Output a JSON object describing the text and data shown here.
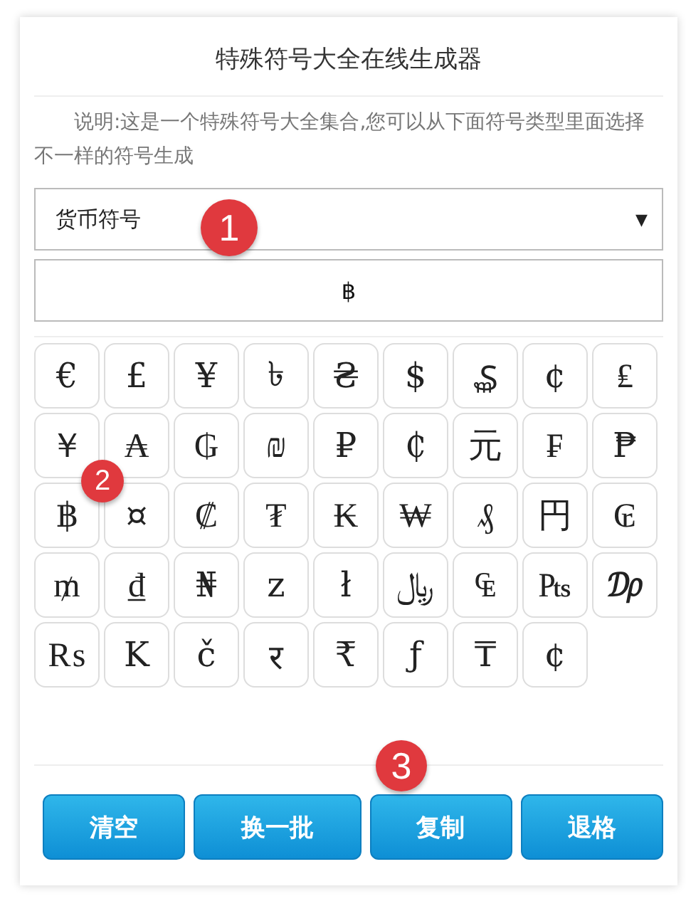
{
  "title": "特殊符号大全在线生成器",
  "description": "说明:这是一个特殊符号大全集合,您可以从下面符号类型里面选择不一样的符号生成",
  "category_select": {
    "value": "货币符号",
    "arrow": "▼"
  },
  "output": {
    "value": "฿"
  },
  "symbols": [
    "€",
    "£",
    "¥",
    "৳",
    "₴",
    "$",
    "₷",
    "¢",
    "₤",
    "￥",
    "₳",
    "₲",
    "₪",
    "₽",
    "₵",
    "元",
    "₣",
    "₱",
    "฿",
    "¤",
    "₡",
    "₮",
    "₭",
    "₩",
    "₰",
    "円",
    "₢",
    "₥",
    "₫",
    "₦",
    "z",
    "ł",
    "﷼",
    "₠",
    "₧",
    "₯",
    "₨",
    "K",
    "č",
    "र",
    "₹",
    "ƒ",
    "₸",
    "¢"
  ],
  "buttons": [
    "清空",
    "换一批",
    "复制",
    "退格"
  ],
  "annotations": [
    "1",
    "2",
    "3"
  ]
}
